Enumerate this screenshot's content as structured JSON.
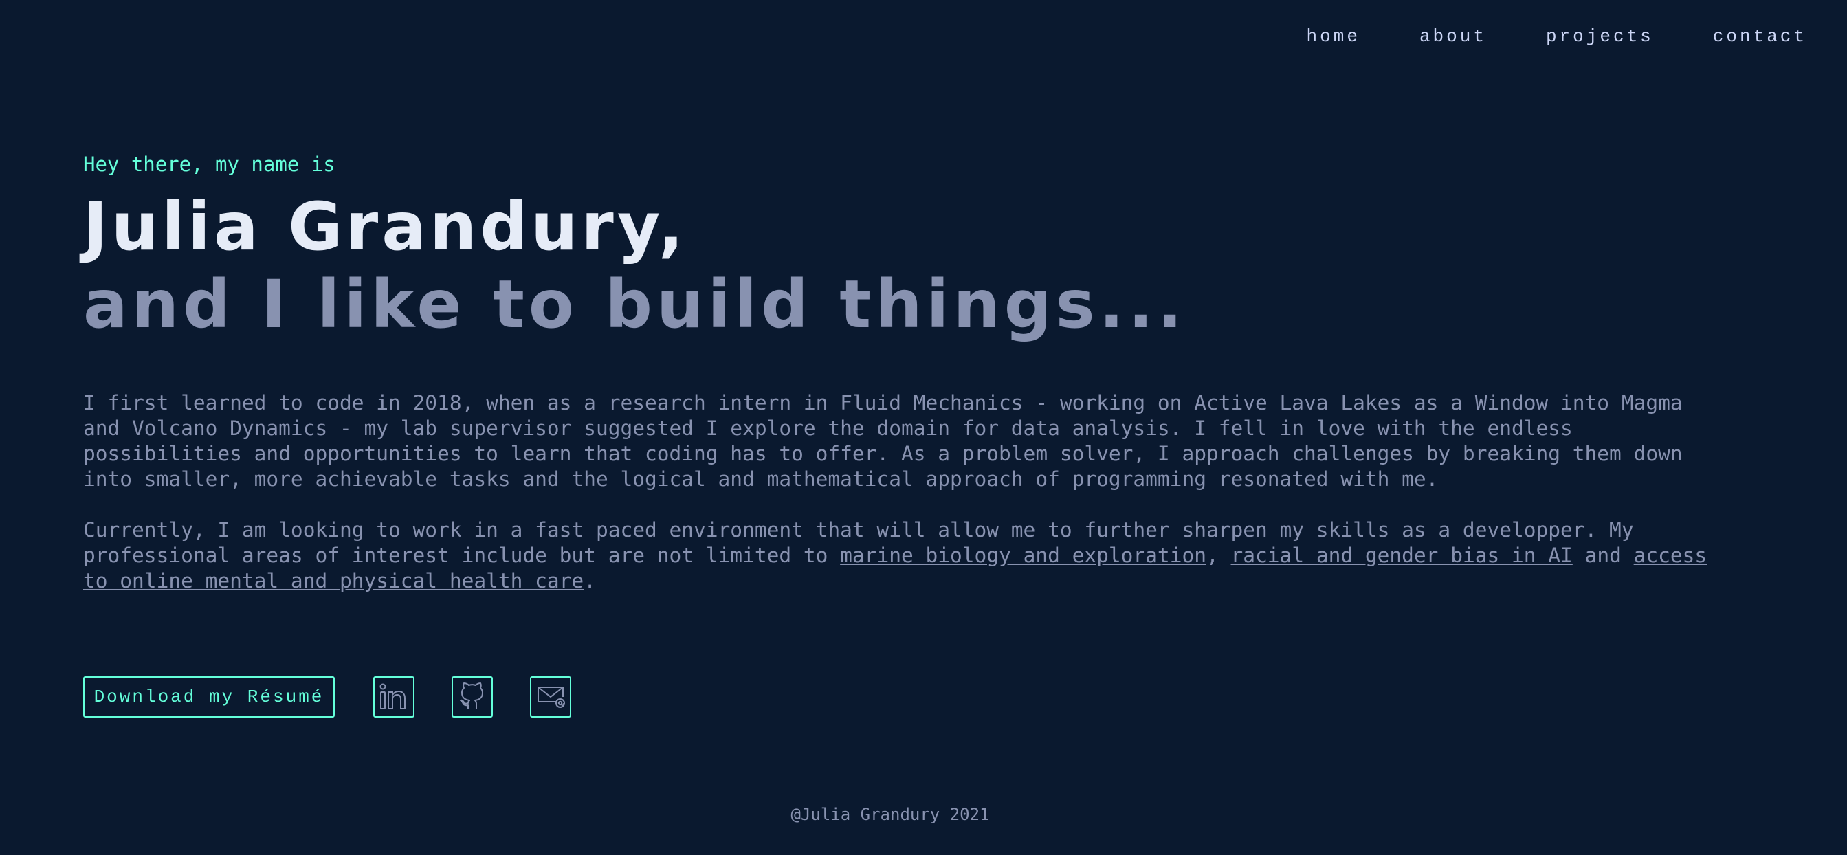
{
  "nav": {
    "items": [
      {
        "label": "home"
      },
      {
        "label": "about"
      },
      {
        "label": "projects"
      },
      {
        "label": "contact"
      }
    ]
  },
  "hero": {
    "intro": "Hey there, my name is",
    "name": "Julia Grandury,",
    "tagline": "and I like to build things..."
  },
  "bio": {
    "paragraph1": "I first learned to code in 2018, when as a research intern in Fluid Mechanics - working on Active Lava Lakes as a Window into Magma and Volcano Dynamics - my lab supervisor suggested I explore the domain for data analysis. I fell in love with the endless possibilities and opportunities to learn that coding has to offer. As a problem solver, I approach challenges by breaking them down into smaller, more achievable tasks and the logical and mathematical approach of programming resonated with me.",
    "paragraph2_start": "Currently, I am looking to work in a fast paced environment that will allow me to further sharpen my skills as a developper. My professional areas of interest include but are not limited to ",
    "link1": "marine biology and exploration",
    "sep1": ", ",
    "link2": "racial and gender bias in AI",
    "sep2": " and ",
    "link3": "access to online mental and physical health care",
    "end": "."
  },
  "actions": {
    "resume_label": "Download my Résumé",
    "icons": [
      "linkedin-icon",
      "github-icon",
      "email-icon"
    ]
  },
  "footer": {
    "text": "@Julia Grandury 2021"
  },
  "colors": {
    "background": "#0a192f",
    "accent": "#64ffda",
    "heading": "#e6ecf7",
    "muted": "#8892b0"
  }
}
